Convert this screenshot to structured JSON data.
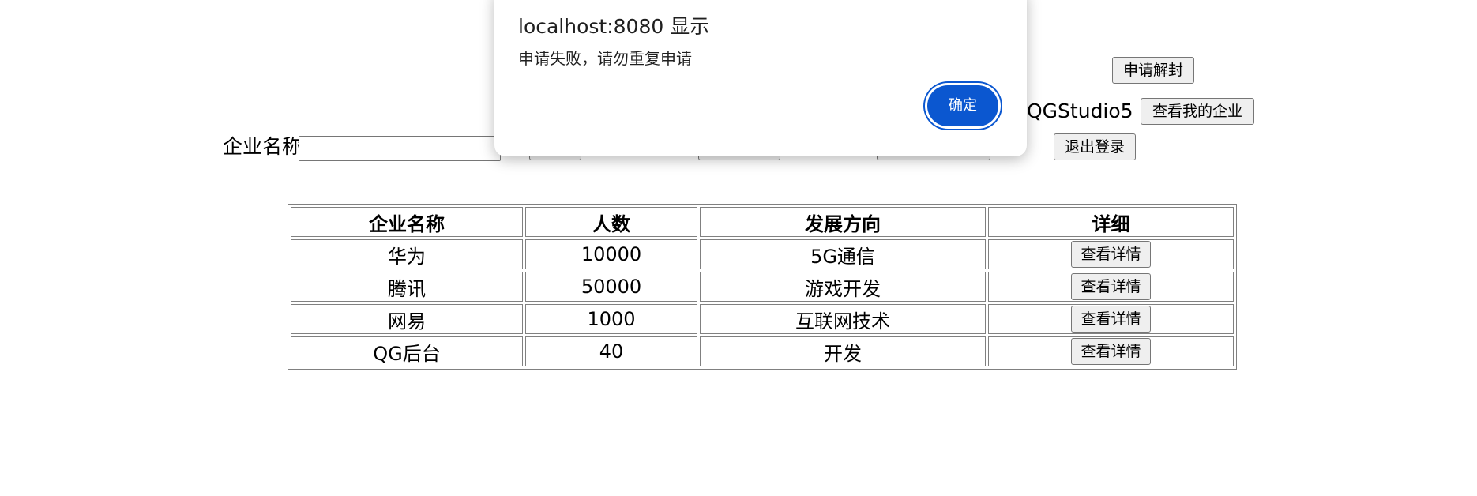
{
  "header": {
    "apply_unban_label": "申请解封",
    "username": "QGStudio5",
    "my_company_label": "查看我的企业",
    "logout_label": "退出登录"
  },
  "search": {
    "company_name_label": "企业名称",
    "company_name_value": ""
  },
  "table": {
    "headers": [
      "企业名称",
      "人数",
      "发展方向",
      "详细"
    ],
    "rows": [
      {
        "name": "华为",
        "count": "10000",
        "direction": "5G通信",
        "action": "查看详情"
      },
      {
        "name": "腾讯",
        "count": "50000",
        "direction": "游戏开发",
        "action": "查看详情"
      },
      {
        "name": "网易",
        "count": "1000",
        "direction": "互联网技术",
        "action": "查看详情"
      },
      {
        "name": "QG后台",
        "count": "40",
        "direction": "开发",
        "action": "查看详情"
      }
    ]
  },
  "dialog": {
    "title": "localhost:8080 显示",
    "message": "申请失败，请勿重复申请",
    "ok_label": "确定",
    "ok_color": "#0b57d0"
  }
}
